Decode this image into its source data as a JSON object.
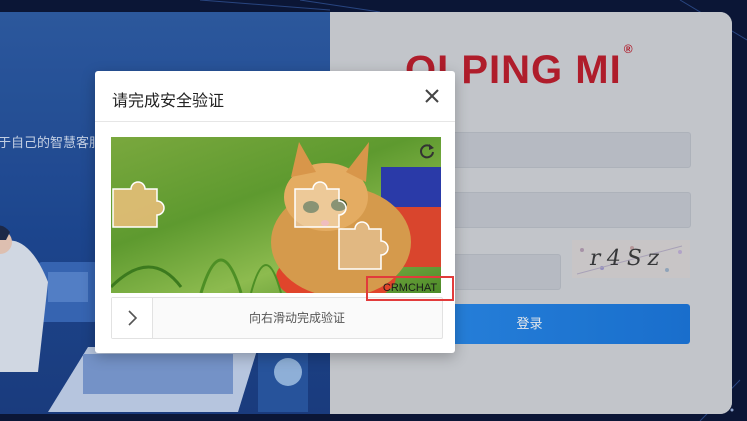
{
  "left_panel": {
    "tagline": "于自己的智慧客服"
  },
  "brand": {
    "name": "QI PING MI",
    "registered_mark": "®",
    "color": "#c11d2b"
  },
  "login": {
    "captcha_text": "r4Sz",
    "submit_label": "登录"
  },
  "dialog": {
    "title": "请完成安全验证",
    "slider_hint": "向右滑动完成验证",
    "icons": {
      "close": "close-icon",
      "refresh": "refresh-icon",
      "handle": "chevron-right-icon"
    }
  },
  "overlay_label": "CRMCHAT",
  "colors": {
    "accent_blue": "#1a78de",
    "highlight_red": "#e23b3b",
    "left_panel": "#2f5fa9"
  }
}
